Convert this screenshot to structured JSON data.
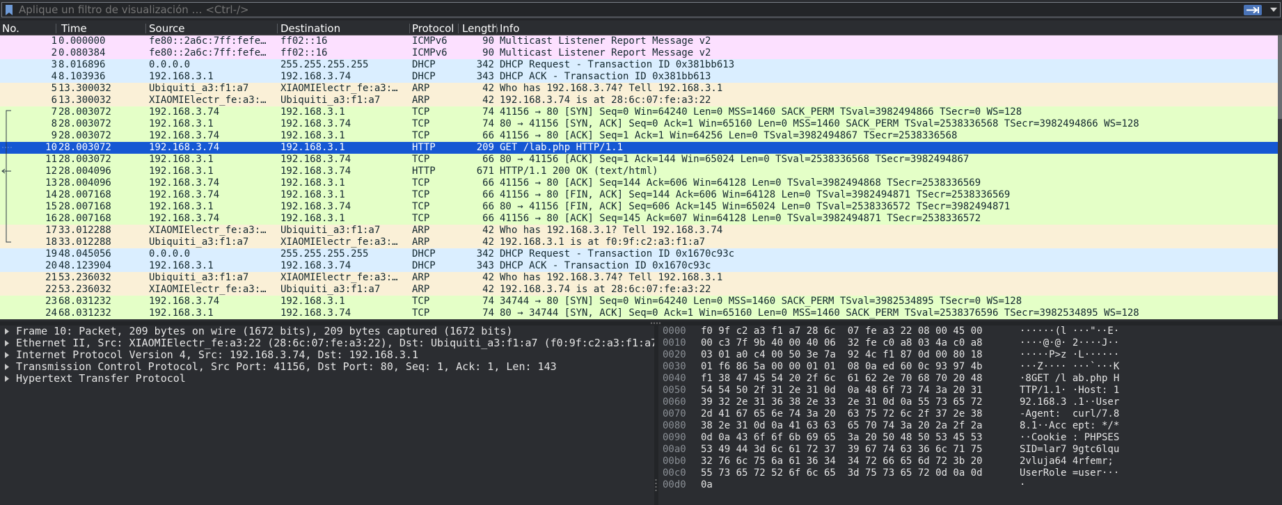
{
  "filter": {
    "placeholder": "Aplique un filtro de visualización … <Ctrl-/>"
  },
  "columns": [
    "No.",
    "Time",
    "Source",
    "Destination",
    "Protocol",
    "Length",
    "Info"
  ],
  "packets": [
    {
      "no": "1",
      "time": "0.000000",
      "src": "fe80::2a6c:7ff:fefe…",
      "dst": "ff02::16",
      "proto": "ICMPv6",
      "len": "90",
      "info": "Multicast Listener Report Message v2",
      "cls": "p-icmpv6"
    },
    {
      "no": "2",
      "time": "0.080384",
      "src": "fe80::2a6c:7ff:fefe…",
      "dst": "ff02::16",
      "proto": "ICMPv6",
      "len": "90",
      "info": "Multicast Listener Report Message v2",
      "cls": "p-icmpv6"
    },
    {
      "no": "3",
      "time": "8.016896",
      "src": "0.0.0.0",
      "dst": "255.255.255.255",
      "proto": "DHCP",
      "len": "342",
      "info": "DHCP Request  - Transaction ID 0x381bb613",
      "cls": "p-dhcp"
    },
    {
      "no": "4",
      "time": "8.103936",
      "src": "192.168.3.1",
      "dst": "192.168.3.74",
      "proto": "DHCP",
      "len": "343",
      "info": "DHCP ACK      - Transaction ID 0x381bb613",
      "cls": "p-dhcp"
    },
    {
      "no": "5",
      "time": "13.300032",
      "src": "Ubiquiti_a3:f1:a7",
      "dst": "XIAOMIElectr_fe:a3:…",
      "proto": "ARP",
      "len": "42",
      "info": "Who has 192.168.3.74? Tell 192.168.3.1",
      "cls": "p-arp"
    },
    {
      "no": "6",
      "time": "13.300032",
      "src": "XIAOMIElectr_fe:a3:…",
      "dst": "Ubiquiti_a3:f1:a7",
      "proto": "ARP",
      "len": "42",
      "info": "192.168.3.74 is at 28:6c:07:fe:a3:22",
      "cls": "p-arp"
    },
    {
      "no": "7",
      "time": "28.003072",
      "src": "192.168.3.74",
      "dst": "192.168.3.1",
      "proto": "TCP",
      "len": "74",
      "info": "41156 → 80 [SYN] Seq=0 Win=64240 Len=0 MSS=1460 SACK_PERM TSval=3982494866 TSecr=0 WS=128",
      "cls": "p-tcpgreen"
    },
    {
      "no": "8",
      "time": "28.003072",
      "src": "192.168.3.1",
      "dst": "192.168.3.74",
      "proto": "TCP",
      "len": "74",
      "info": "80 → 41156 [SYN, ACK] Seq=0 Ack=1 Win=65160 Len=0 MSS=1460 SACK_PERM TSval=2538336568 TSecr=3982494866 WS=128",
      "cls": "p-tcpgreen"
    },
    {
      "no": "9",
      "time": "28.003072",
      "src": "192.168.3.74",
      "dst": "192.168.3.1",
      "proto": "TCP",
      "len": "66",
      "info": "41156 → 80 [ACK] Seq=1 Ack=1 Win=64256 Len=0 TSval=3982494867 TSecr=2538336568",
      "cls": "p-tcpgreen"
    },
    {
      "no": "10",
      "time": "28.003072",
      "src": "192.168.3.74",
      "dst": "192.168.3.1",
      "proto": "HTTP",
      "len": "209",
      "info": "GET /lab.php HTTP/1.1",
      "cls": "p-http selected"
    },
    {
      "no": "11",
      "time": "28.003072",
      "src": "192.168.3.1",
      "dst": "192.168.3.74",
      "proto": "TCP",
      "len": "66",
      "info": "80 → 41156 [ACK] Seq=1 Ack=144 Win=65024 Len=0 TSval=2538336568 TSecr=3982494867",
      "cls": "p-tcpgreen"
    },
    {
      "no": "12",
      "time": "28.004096",
      "src": "192.168.3.1",
      "dst": "192.168.3.74",
      "proto": "HTTP",
      "len": "671",
      "info": "HTTP/1.1 200 OK  (text/html)",
      "cls": "p-http"
    },
    {
      "no": "13",
      "time": "28.004096",
      "src": "192.168.3.74",
      "dst": "192.168.3.1",
      "proto": "TCP",
      "len": "66",
      "info": "41156 → 80 [ACK] Seq=144 Ack=606 Win=64128 Len=0 TSval=3982494868 TSecr=2538336569",
      "cls": "p-tcpgreen"
    },
    {
      "no": "14",
      "time": "28.007168",
      "src": "192.168.3.74",
      "dst": "192.168.3.1",
      "proto": "TCP",
      "len": "66",
      "info": "41156 → 80 [FIN, ACK] Seq=144 Ack=606 Win=64128 Len=0 TSval=3982494871 TSecr=2538336569",
      "cls": "p-tcpgreen"
    },
    {
      "no": "15",
      "time": "28.007168",
      "src": "192.168.3.1",
      "dst": "192.168.3.74",
      "proto": "TCP",
      "len": "66",
      "info": "80 → 41156 [FIN, ACK] Seq=606 Ack=145 Win=65024 Len=0 TSval=2538336572 TSecr=3982494871",
      "cls": "p-tcpgreen"
    },
    {
      "no": "16",
      "time": "28.007168",
      "src": "192.168.3.74",
      "dst": "192.168.3.1",
      "proto": "TCP",
      "len": "66",
      "info": "41156 → 80 [ACK] Seq=145 Ack=607 Win=64128 Len=0 TSval=3982494871 TSecr=2538336572",
      "cls": "p-tcpgreen"
    },
    {
      "no": "17",
      "time": "33.012288",
      "src": "XIAOMIElectr_fe:a3:…",
      "dst": "Ubiquiti_a3:f1:a7",
      "proto": "ARP",
      "len": "42",
      "info": "Who has 192.168.3.1? Tell 192.168.3.74",
      "cls": "p-arp"
    },
    {
      "no": "18",
      "time": "33.012288",
      "src": "Ubiquiti_a3:f1:a7",
      "dst": "XIAOMIElectr_fe:a3:…",
      "proto": "ARP",
      "len": "42",
      "info": "192.168.3.1 is at f0:9f:c2:a3:f1:a7",
      "cls": "p-arp"
    },
    {
      "no": "19",
      "time": "48.045056",
      "src": "0.0.0.0",
      "dst": "255.255.255.255",
      "proto": "DHCP",
      "len": "342",
      "info": "DHCP Request  - Transaction ID 0x1670c93c",
      "cls": "p-dhcp"
    },
    {
      "no": "20",
      "time": "48.123904",
      "src": "192.168.3.1",
      "dst": "192.168.3.74",
      "proto": "DHCP",
      "len": "343",
      "info": "DHCP ACK      - Transaction ID 0x1670c93c",
      "cls": "p-dhcp"
    },
    {
      "no": "21",
      "time": "53.236032",
      "src": "Ubiquiti_a3:f1:a7",
      "dst": "XIAOMIElectr_fe:a3:…",
      "proto": "ARP",
      "len": "42",
      "info": "Who has 192.168.3.74? Tell 192.168.3.1",
      "cls": "p-arp"
    },
    {
      "no": "22",
      "time": "53.236032",
      "src": "XIAOMIElectr_fe:a3:…",
      "dst": "Ubiquiti_a3:f1:a7",
      "proto": "ARP",
      "len": "42",
      "info": "192.168.3.74 is at 28:6c:07:fe:a3:22",
      "cls": "p-arp"
    },
    {
      "no": "23",
      "time": "68.031232",
      "src": "192.168.3.74",
      "dst": "192.168.3.1",
      "proto": "TCP",
      "len": "74",
      "info": "34744 → 80 [SYN] Seq=0 Win=64240 Len=0 MSS=1460 SACK_PERM TSval=3982534895 TSecr=0 WS=128",
      "cls": "p-tcpgreen"
    },
    {
      "no": "24",
      "time": "68.031232",
      "src": "192.168.3.1",
      "dst": "192.168.3.74",
      "proto": "TCP",
      "len": "74",
      "info": "80 → 34744 [SYN, ACK] Seq=0 Ack=1 Win=65160 Len=0 MSS=1460 SACK_PERM TSval=2538376596 TSecr=3982534895 WS=128",
      "cls": "p-tcpgreen"
    }
  ],
  "details": [
    "Frame 10: Packet, 209 bytes on wire (1672 bits), 209 bytes captured (1672 bits)",
    "Ethernet II, Src: XIAOMIElectr_fe:a3:22 (28:6c:07:fe:a3:22), Dst: Ubiquiti_a3:f1:a7 (f0:9f:c2:a3:f1:a7",
    "Internet Protocol Version 4, Src: 192.168.3.74, Dst: 192.168.3.1",
    "Transmission Control Protocol, Src Port: 41156, Dst Port: 80, Seq: 1, Ack: 1, Len: 143",
    "Hypertext Transfer Protocol"
  ],
  "bytes": [
    {
      "off": "0000",
      "hex": "f0 9f c2 a3 f1 a7 28 6c  07 fe a3 22 08 00 45 00",
      "ascii": "······(l ···\"··E·"
    },
    {
      "off": "0010",
      "hex": "00 c3 7f 9b 40 00 40 06  32 fe c0 a8 03 4a c0 a8",
      "ascii": "····@·@· 2····J··"
    },
    {
      "off": "0020",
      "hex": "03 01 a0 c4 00 50 3e 7a  92 4c f1 87 0d 00 80 18",
      "ascii": "·····P>z ·L······"
    },
    {
      "off": "0030",
      "hex": "01 f6 86 5a 00 00 01 01  08 0a ed 60 0c 93 97 4b",
      "ascii": "···Z···· ···`···K"
    },
    {
      "off": "0040",
      "hex": "f1 38 47 45 54 20 2f 6c  61 62 2e 70 68 70 20 48",
      "ascii": "·8GET /l ab.php H"
    },
    {
      "off": "0050",
      "hex": "54 54 50 2f 31 2e 31 0d  0a 48 6f 73 74 3a 20 31",
      "ascii": "TTP/1.1· ·Host: 1"
    },
    {
      "off": "0060",
      "hex": "39 32 2e 31 36 38 2e 33  2e 31 0d 0a 55 73 65 72",
      "ascii": "92.168.3 .1··User"
    },
    {
      "off": "0070",
      "hex": "2d 41 67 65 6e 74 3a 20  63 75 72 6c 2f 37 2e 38",
      "ascii": "-Agent:  curl/7.8"
    },
    {
      "off": "0080",
      "hex": "38 2e 31 0d 0a 41 63 63  65 70 74 3a 20 2a 2f 2a",
      "ascii": "8.1··Acc ept: */*"
    },
    {
      "off": "0090",
      "hex": "0d 0a 43 6f 6f 6b 69 65  3a 20 50 48 50 53 45 53",
      "ascii": "··Cookie : PHPSES"
    },
    {
      "off": "00a0",
      "hex": "53 49 44 3d 6c 61 72 37  39 67 74 63 36 6c 71 75",
      "ascii": "SID=lar7 9gtc6lqu"
    },
    {
      "off": "00b0",
      "hex": "32 76 6c 75 6a 61 36 34  34 72 66 65 6d 72 3b 20",
      "ascii": "2vluja64 4rfemr; "
    },
    {
      "off": "00c0",
      "hex": "55 73 65 72 52 6f 6c 65  3d 75 73 65 72 0d 0a 0d",
      "ascii": "UserRole =user···"
    },
    {
      "off": "00d0",
      "hex": "0a",
      "ascii": "·"
    }
  ]
}
